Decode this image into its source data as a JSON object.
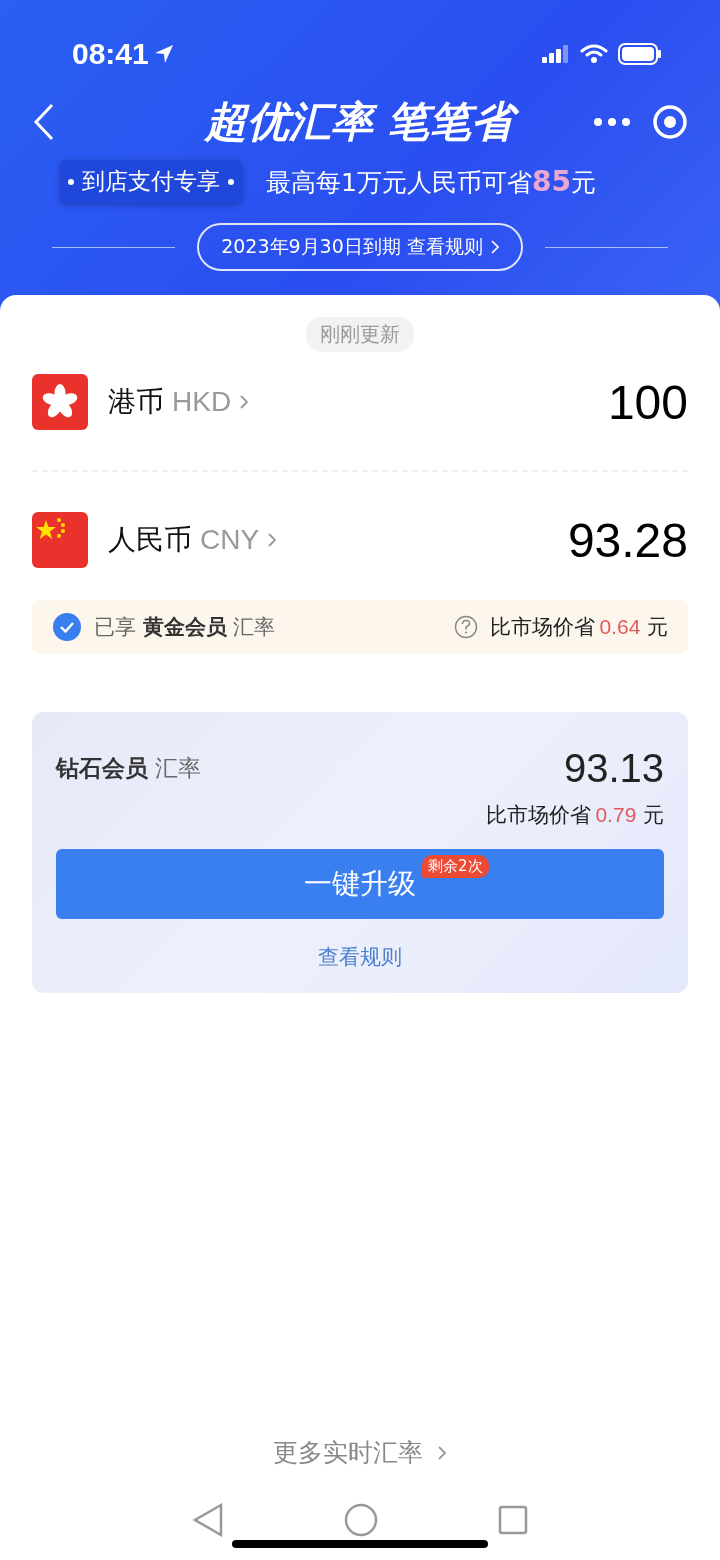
{
  "status_bar": {
    "time": "08:41"
  },
  "header": {
    "title": "超优汇率 笔笔省",
    "tag": "到店支付专享",
    "promo_text": "最高每1万元人民币可省",
    "promo_amount": "85",
    "promo_unit": "元",
    "expiry": "2023年9月30日到期 查看规则"
  },
  "updated_badge": "刚刚更新",
  "currencies": [
    {
      "kind": "hk",
      "name": "港币",
      "code": "HKD",
      "amount": "100"
    },
    {
      "kind": "cn",
      "name": "人民币",
      "code": "CNY",
      "amount": "93.28"
    }
  ],
  "member_notice": {
    "checked": true,
    "prefix": "已享",
    "tier": "黄金会员",
    "suffix": "汇率",
    "savings_label": "比市场价省",
    "savings_amount": "0.64",
    "unit": "元"
  },
  "upgrade_card": {
    "tier": "钻石会员",
    "label": "汇率",
    "rate": "93.13",
    "savings_label": "比市场价省",
    "savings_amount": "0.79",
    "unit": "元",
    "button": "一键升级",
    "badge": "剩余2次",
    "rules_link": "查看规则"
  },
  "more_link": "更多实时汇率"
}
